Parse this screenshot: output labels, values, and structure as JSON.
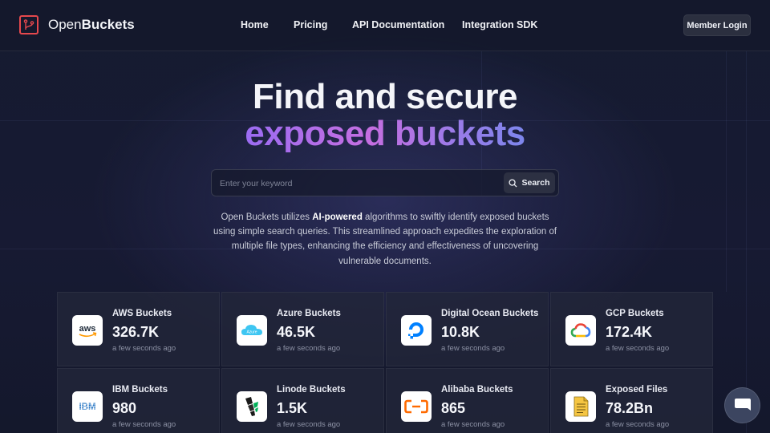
{
  "header": {
    "brand_prefix": "Open",
    "brand_suffix": "Buckets",
    "nav": [
      "Home",
      "Pricing",
      "API Documentation",
      "Integration SDK"
    ],
    "login_label": "Member Login"
  },
  "hero": {
    "line1": "Find and secure",
    "line2": "exposed buckets"
  },
  "search": {
    "placeholder": "Enter your keyword",
    "button_label": "Search"
  },
  "description": {
    "before": "Open Buckets utilizes ",
    "highlight": "AI-powered",
    "after": " algorithms to swiftly identify exposed buckets using simple search queries. This streamlined approach expedites the exploration of multiple file types, enhancing the efficiency and effectiveness of uncovering vulnerable documents."
  },
  "stats": [
    {
      "name": "AWS Buckets",
      "count": "326.7K",
      "time": "a few seconds ago",
      "icon": "aws-icon"
    },
    {
      "name": "Azure Buckets",
      "count": "46.5K",
      "time": "a few seconds ago",
      "icon": "azure-icon"
    },
    {
      "name": "Digital Ocean Buckets",
      "count": "10.8K",
      "time": "a few seconds ago",
      "icon": "digital-ocean-icon"
    },
    {
      "name": "GCP Buckets",
      "count": "172.4K",
      "time": "a few seconds ago",
      "icon": "gcp-icon"
    },
    {
      "name": "IBM Buckets",
      "count": "980",
      "time": "a few seconds ago",
      "icon": "ibm-icon"
    },
    {
      "name": "Linode Buckets",
      "count": "1.5K",
      "time": "a few seconds ago",
      "icon": "linode-icon"
    },
    {
      "name": "Alibaba Buckets",
      "count": "865",
      "time": "a few seconds ago",
      "icon": "alibaba-icon"
    },
    {
      "name": "Exposed Files",
      "count": "78.2Bn",
      "time": "a few seconds ago",
      "icon": "file-icon"
    }
  ],
  "icon_text": {
    "aws": "aws",
    "azure": "Azure",
    "ibm": "IBM"
  },
  "colors": {
    "accent_red": "#e5484d",
    "gradient_start": "#9b6cf2",
    "gradient_end": "#7d86ec"
  }
}
